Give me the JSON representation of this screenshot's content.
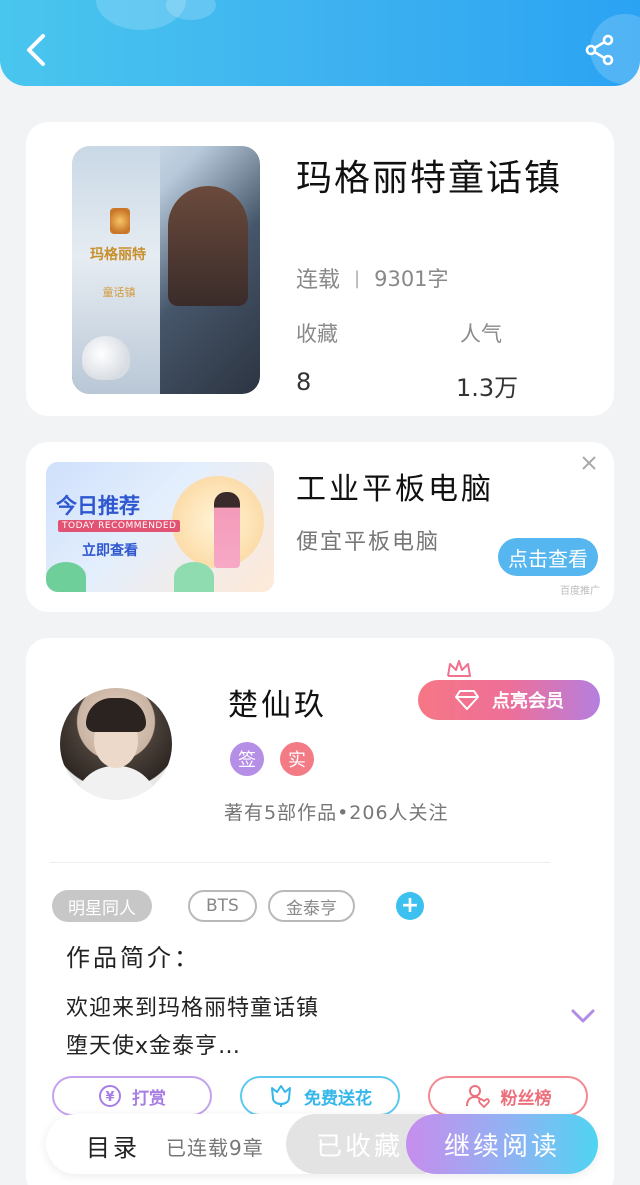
{
  "header": {
    "back_icon": "chevron-left-icon",
    "share_icon": "share-icon",
    "colors": {
      "start": "#49c6ee",
      "end": "#2aa3f3"
    }
  },
  "book": {
    "title": "玛格丽特童话镇",
    "status": "连载",
    "chapters": "9301字",
    "favorites_label": "收藏",
    "favorites_value": "8",
    "popularity_label": "人气",
    "popularity_value": "1.3万",
    "cover": {
      "title": "玛格丽特",
      "subtitle": "童话镇"
    }
  },
  "ad": {
    "banner_title": "今日推荐",
    "banner_en": "TODAY RECOMMENDED",
    "banner_cta": "立即查看",
    "title": "工业平板电脑",
    "description": "便宜平板电脑",
    "button": "点击查看",
    "source": "百度推广"
  },
  "author": {
    "name": "楚仙玖",
    "vip_button": "点亮会员",
    "badges": [
      "签",
      "实"
    ],
    "meta": "著有5部作品•206人关注",
    "tags": [
      "明星同人",
      "BTS",
      "金泰亨"
    ],
    "intro_label": "作品简介：",
    "intro_line1": "欢迎来到玛格丽特童话镇",
    "intro_line2": "堕天使x金泰亨…",
    "actions": {
      "tip": "打赏",
      "flower": "免费送花",
      "fans": "粉丝榜"
    }
  },
  "bottom_bar": {
    "catalog": "目录",
    "chapter_count": "已连载9章",
    "favorite": "已收藏",
    "continue": "继续阅读"
  }
}
